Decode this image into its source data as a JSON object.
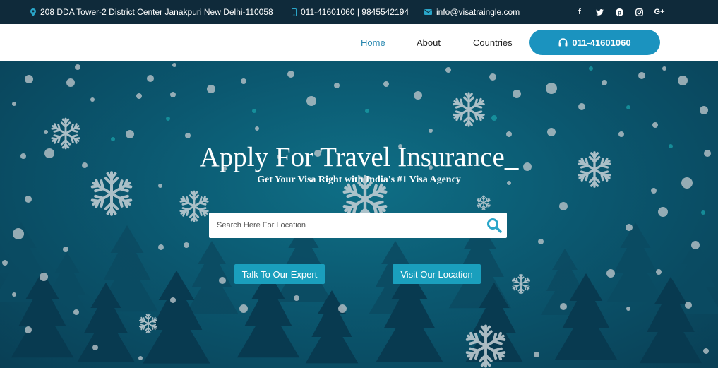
{
  "topbar": {
    "address": "208 DDA Tower-2 District Center Janakpuri New Delhi-110058",
    "phone": "011-41601060 | 9845542194",
    "email": "info@visatraingle.com",
    "address_icon": "map-pin-icon",
    "phone_icon": "mobile-phone-icon",
    "email_icon": "envelope-icon",
    "socials": [
      "facebook-icon",
      "twitter-icon",
      "pinterest-icon",
      "instagram-icon",
      "google-plus-icon"
    ]
  },
  "nav": {
    "links": [
      "Home",
      "About",
      "Countries"
    ],
    "active": "Home",
    "call_button": "011-41601060",
    "call_icon": "headphones-icon"
  },
  "hero": {
    "title": "Apply For Travel Insurance_",
    "subtitle": "Get Your Visa Right with India's #1 Visa Agency",
    "search_placeholder": "Search Here For Location",
    "buttons": [
      "Talk To Our Expert",
      "Visit Our Location"
    ]
  },
  "colors": {
    "topbar_bg": "#0f2a3a",
    "accent": "#1b93bf",
    "active_link": "#2a88b0",
    "hero_bg": "#0b5870",
    "hero_button": "#1a9fbd"
  }
}
